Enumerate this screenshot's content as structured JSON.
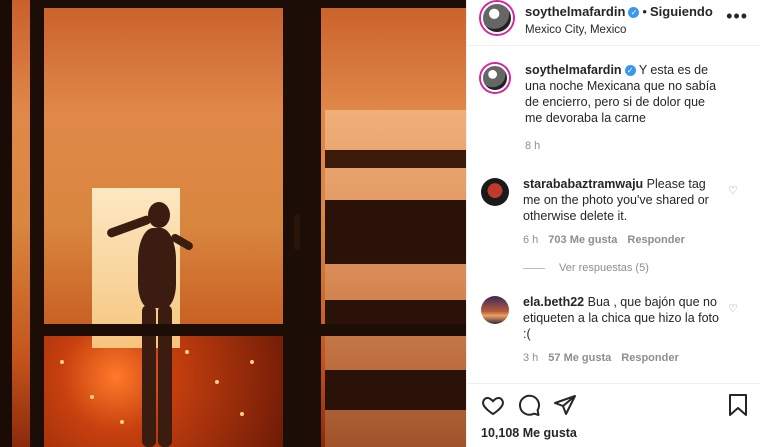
{
  "header": {
    "username": "soythelmafardin",
    "separator": "•",
    "follow_status": "Siguiendo",
    "location": "Mexico City, Mexico",
    "more_label": "•••"
  },
  "caption": {
    "username": "soythelmafardin",
    "text": "Y esta es de una noche Mexicana que no sabía de encierro, pero si de dolor que me devoraba la carne",
    "time": "8 h"
  },
  "comments": [
    {
      "username": "starababaztramwaju",
      "text": "Please tag me on the photo you've shared or otherwise delete it.",
      "time": "6 h",
      "likes": "703 Me gusta",
      "reply_label": "Responder"
    },
    {
      "username": "ela.beth22",
      "text": "Bua , que bajón que no etiqueten a la chica que hizo la foto :(",
      "time": "3 h",
      "likes": "57 Me gusta",
      "reply_label": "Responder"
    }
  ],
  "view_replies": "Ver respuestas (5)",
  "actions": {
    "like_icon": "heart-icon",
    "comment_icon": "comment-icon",
    "share_icon": "share-icon",
    "save_icon": "bookmark-icon",
    "likes_count": "10,108 Me gusta"
  },
  "colors": {
    "verified": "#3897f0",
    "story_ring": "#d6249f",
    "muted_text": "#8e8e8e"
  }
}
